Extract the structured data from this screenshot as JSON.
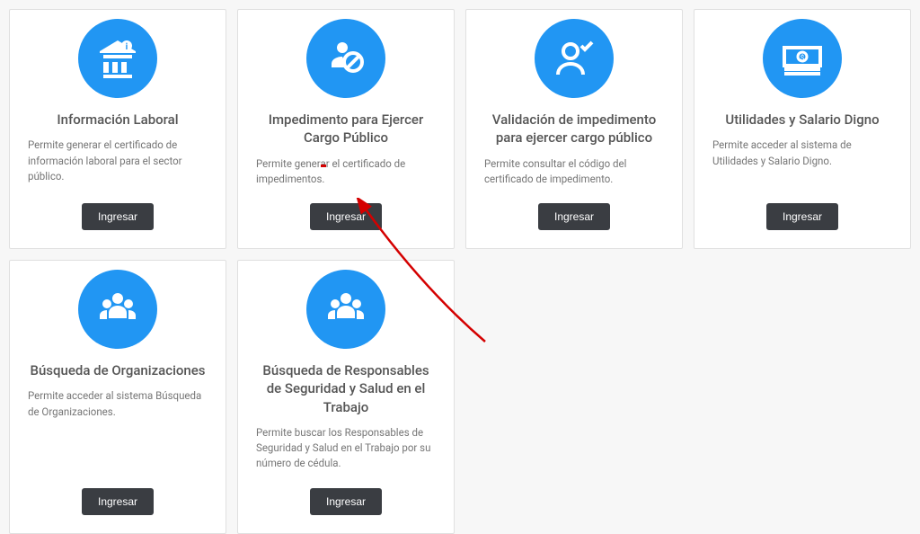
{
  "cards": [
    {
      "title": "Información Laboral",
      "desc": "Permite generar el certificado de información laboral para el sector público.",
      "button": "Ingresar"
    },
    {
      "title": "Impedimento para Ejercer Cargo Público",
      "desc": "Permite generar el certificado de impedimentos.",
      "button": "Ingresar"
    },
    {
      "title": "Validación de impedimento para ejercer cargo público",
      "desc": "Permite consultar el código del certificado de impedimento.",
      "button": "Ingresar"
    },
    {
      "title": "Utilidades y Salario Digno",
      "desc": "Permite acceder al sistema de Utilidades y Salario Digno.",
      "button": "Ingresar"
    },
    {
      "title": "Búsqueda de Organizaciones",
      "desc": "Permite acceder al sistema Búsqueda de Organizaciones.",
      "button": "Ingresar"
    },
    {
      "title": "Búsqueda de Responsables de Seguridad y Salud en el Trabajo",
      "desc": "Permite buscar los Responsables de Seguridad y Salud en el Trabajo por su número de cédula.",
      "button": "Ingresar"
    }
  ]
}
